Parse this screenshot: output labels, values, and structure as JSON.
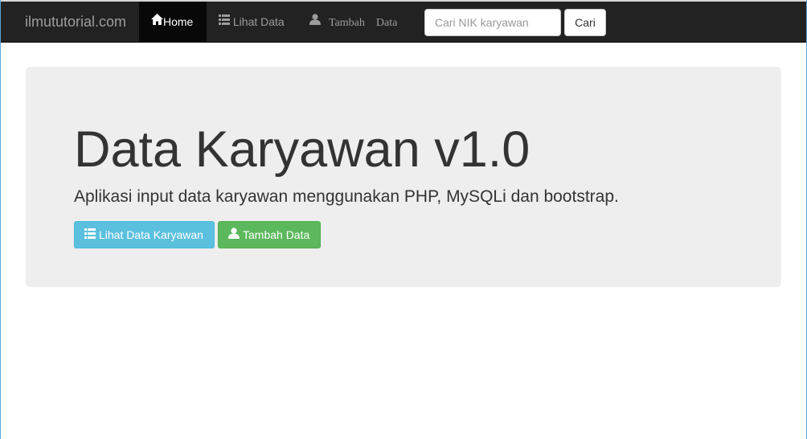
{
  "navbar": {
    "brand": "ilmututorial.com",
    "items": [
      {
        "label": "Home",
        "icon": "home-icon",
        "active": true
      },
      {
        "label": "Lihat Data",
        "icon": "list-icon",
        "active": false
      },
      {
        "label_part1": "Tambah",
        "label_part2": "Data",
        "icon": "user-icon",
        "active": false
      }
    ],
    "search": {
      "placeholder": "Cari NIK karyawan",
      "value": "",
      "button_label": "Cari"
    }
  },
  "jumbotron": {
    "title": "Data Karyawan v1.0",
    "subtitle": "Aplikasi input data karyawan menggunakan PHP, MySQLi dan bootstrap.",
    "buttons": [
      {
        "label": "Lihat Data Karyawan",
        "icon": "list-icon",
        "color": "#5bc0de"
      },
      {
        "label": "Tambah Data",
        "icon": "user-icon",
        "color": "#5cb85c"
      }
    ]
  },
  "colors": {
    "navbar_bg": "#222222",
    "active_bg": "#080808",
    "jumbotron_bg": "#eeeeee"
  }
}
